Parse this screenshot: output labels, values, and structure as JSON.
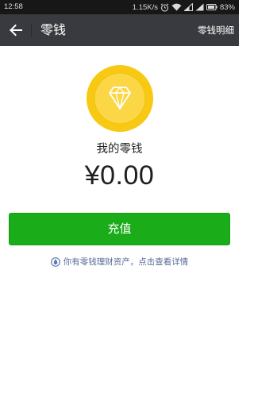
{
  "status_bar": {
    "time": "12:58",
    "network_speed": "1.15K/s",
    "battery": "83%",
    "icons": [
      "alarm-icon",
      "wifi-icon",
      "signal-icon",
      "signal-icon",
      "battery-icon"
    ]
  },
  "app_bar": {
    "title": "零钱",
    "details_label": "零钱明细",
    "back_icon": "arrow-left-icon",
    "background": "#393a3f"
  },
  "balance": {
    "coin_icon": "diamond-coin-icon",
    "label": "我的零钱",
    "amount": "¥0.00"
  },
  "actions": {
    "topup_label": "充值",
    "topup_color": "#1aad19"
  },
  "wealth_link": {
    "icon": "wealth-drop-icon",
    "text": "你有零钱理财资产，点击查看详情",
    "color": "#576b95"
  }
}
